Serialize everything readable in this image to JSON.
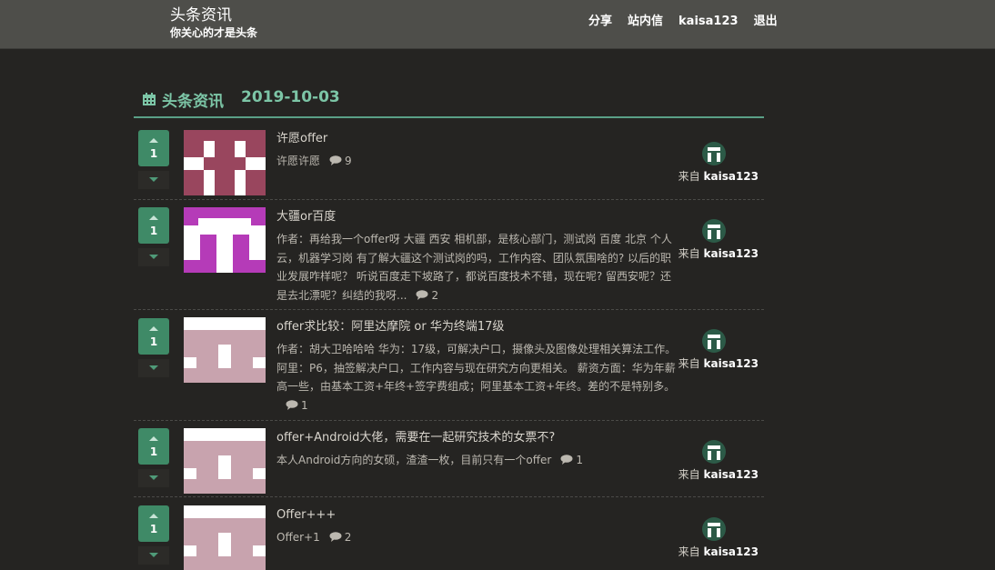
{
  "header": {
    "title": "头条资讯",
    "subtitle": "你关心的才是头条",
    "nav": [
      "分享",
      "站内信",
      "kaisa123",
      "退出"
    ]
  },
  "section": {
    "title": "头条资讯",
    "date": "2019-10-03"
  },
  "from_label": "来自",
  "colors": {
    "accent": "#3f8a67",
    "heading": "#7cc5a6"
  },
  "posts": [
    {
      "votes": "1",
      "title": "许愿offer",
      "body": "许愿许愿",
      "comments": "9",
      "author": "kaisa123"
    },
    {
      "votes": "1",
      "title": "大疆or百度",
      "body": "作者：再给我一个offer呀 大疆 西安 相机部，是核心部门，测试岗 百度 北京 个人云，机器学习岗 有了解大疆这个测试岗的吗，工作内容、团队氛围啥的? 以后的职业发展咋样呢？ 听说百度走下坡路了，都说百度技术不错，现在呢? 留西安呢？还是去北漂呢？纠结的我呀...",
      "comments": "2",
      "author": "kaisa123"
    },
    {
      "votes": "1",
      "title": "offer求比较：阿里达摩院 or 华为终端17级",
      "body": "作者：胡大卫哈哈哈 华为：17级，可解决户口，摄像头及图像处理相关算法工作。阿里：P6，抽签解决户口，工作内容与现在研究方向更相关。 薪资方面：华为年薪高一些，由基本工资+年终+签字费组成；阿里基本工资+年终。差的不是特别多。",
      "comments": "1",
      "author": "kaisa123"
    },
    {
      "votes": "1",
      "title": "offer+Android大佬，需要在一起研究技术的女票不?",
      "body": "本人Android方向的女硕，渣渣一枚，目前只有一个offer",
      "comments": "1",
      "author": "kaisa123"
    },
    {
      "votes": "1",
      "title": "Offer+++",
      "body": "Offer+1",
      "comments": "2",
      "author": "kaisa123"
    }
  ]
}
